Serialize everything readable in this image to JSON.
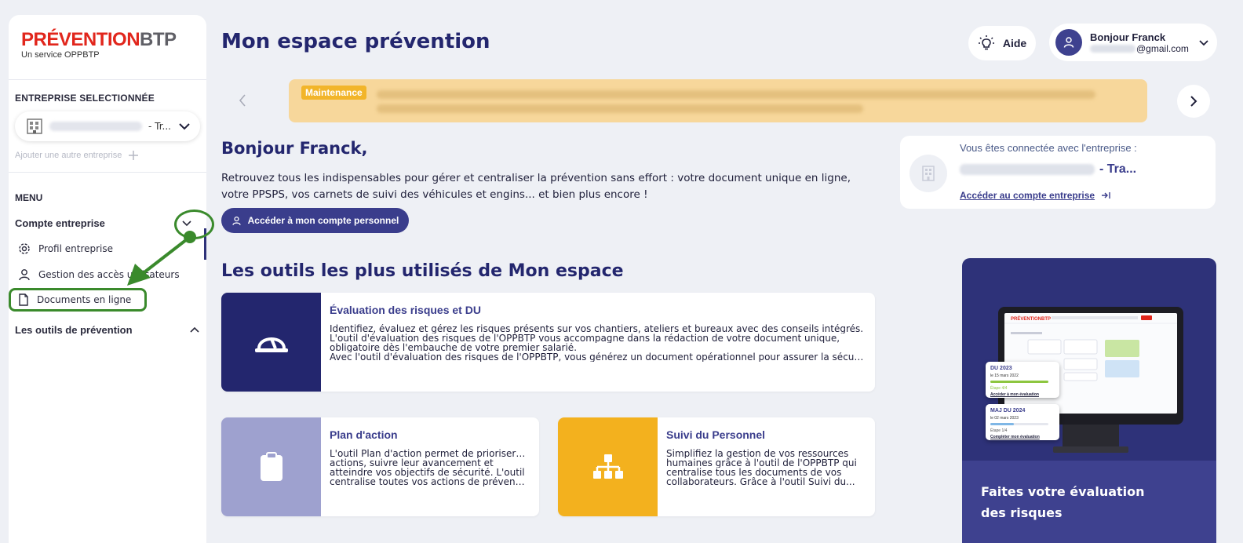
{
  "sidebar": {
    "logo": {
      "part1": "PRÉVENTION",
      "part2": "BTP",
      "subtitle": "Un service OPPBTP"
    },
    "selected_company_title": "ENTREPRISE SELECTIONNÉE",
    "selected_company_suffix": "- Tr...",
    "add_company_label": "Ajouter une autre entreprise",
    "menu_title": "MENU",
    "group_company_account": "Compte entreprise",
    "items": [
      {
        "label": "Profil entreprise",
        "icon": "gear-icon"
      },
      {
        "label": "Gestion des accès utilisateurs",
        "icon": "user-icon"
      },
      {
        "label": "Documents en ligne",
        "icon": "document-icon"
      }
    ],
    "group_prevention_tools": "Les outils de prévention"
  },
  "header": {
    "title": "Mon espace prévention",
    "help_label": "Aide",
    "user_greeting": "Bonjour Franck",
    "user_email_suffix": "@gmail.com"
  },
  "banner": {
    "tag": "Maintenance",
    "colors": {
      "background": "#f7d79b",
      "tag": "#f2b52a"
    }
  },
  "greeting": {
    "title": "Bonjour Franck,",
    "intro_line1": "Retrouvez tous les indispensables pour gérer et centraliser la prévention sans effort : votre document unique en ligne,",
    "intro_line2": "votre PPSPS, vos carnets de suivi des véhicules et engins... et bien plus encore !",
    "personal_account_button": "Accéder à mon compte personnel"
  },
  "company_card": {
    "label": "Vous êtes connectée avec l'entreprise :",
    "name_suffix": "- Tra...",
    "link": "Accéder au compte entreprise"
  },
  "tools": {
    "title": "Les outils les plus utilisés de Mon espace",
    "cards": [
      {
        "title": "Évaluation des risques et DU",
        "lines": [
          "Identifiez, évaluez et gérez les risques présents sur vos chantiers, ateliers et bureaux avec des conseils intégrés.",
          "L'outil d'évaluation des risques de l'OPPBTP vous accompagne dans la rédaction de votre document unique,",
          "obligatoire dès l'embauche de votre premier salarié.",
          "Avec l'outil d'évaluation des risques de l'OPPBTP, vous générez un document opérationnel pour assurer la sécurité ..."
        ],
        "icon": "helmet-icon",
        "color": "#23266e"
      },
      {
        "title": "Plan d'action",
        "lines": [
          "L'outil Plan d'action permet de prioriser vos",
          "actions, suivre leur avancement et",
          "atteindre vos objectifs de sécurité. L'outil",
          "centralise toutes vos actions de préventi..."
        ],
        "icon": "clipboard-icon",
        "color": "#9ea1cf"
      },
      {
        "title": "Suivi du Personnel",
        "lines": [
          "Simplifiez la gestion de vos ressources",
          "humaines grâce à l'outil de l'OPPBTP qui",
          "centralise tous les documents de vos",
          "collaborateurs. Grâce à l'outil Suivi du..."
        ],
        "icon": "org-chart-icon",
        "color": "#f3b11e"
      }
    ]
  },
  "promo": {
    "line1": "Faites votre évaluation",
    "line2": "des risques",
    "mini_cards": [
      {
        "title": "DU 2023",
        "date": "le 15 mars 2022",
        "step": "Étape 4/4",
        "action": "Accéder à mon évaluation",
        "progress": 1.0,
        "color": "#8dc63f"
      },
      {
        "title": "MAJ DU 2024",
        "date": "le 02 mars 2023",
        "step": "Étape 1/4",
        "action": "Compléter mon évaluation",
        "progress": 0.4,
        "color": "#7fb7e6"
      }
    ]
  },
  "annotation": {
    "color": "#3a8a2c"
  }
}
